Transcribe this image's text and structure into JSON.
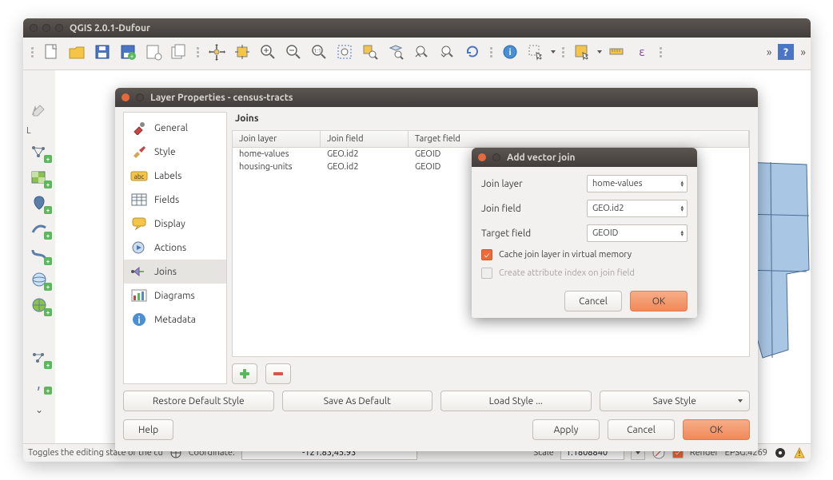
{
  "main_window": {
    "title": "QGIS 2.0.1-Dufour"
  },
  "layers_panel_label_fragment": "L",
  "statusbar": {
    "hint": "Toggles the editing state of the cu",
    "coord_label": "Coordinate:",
    "coord_value": "-121.83,45.93",
    "scale_label": "Scale",
    "scale_value": "1:1808840",
    "render_label": "Render",
    "crs": "EPSG:4269"
  },
  "props_dialog": {
    "title": "Layer Properties - census-tracts",
    "nav": [
      "General",
      "Style",
      "Labels",
      "Fields",
      "Display",
      "Actions",
      "Joins",
      "Diagrams",
      "Metadata"
    ],
    "content_title": "Joins",
    "table": {
      "headers": [
        "Join layer",
        "Join field",
        "Target field"
      ],
      "rows": [
        {
          "layer": "home-values",
          "field": "GEO.id2",
          "target": "GEOID"
        },
        {
          "layer": "housing-units",
          "field": "GEO.id2",
          "target": "GEOID"
        }
      ]
    },
    "style_buttons": [
      "Restore Default Style",
      "Save As Default",
      "Load Style ...",
      "Save Style"
    ],
    "help": "Help",
    "apply": "Apply",
    "cancel": "Cancel",
    "ok": "OK"
  },
  "join_dialog": {
    "title": "Add vector join",
    "join_layer_label": "Join layer",
    "join_layer_value": "home-values",
    "join_field_label": "Join field",
    "join_field_value": "GEO.id2",
    "target_field_label": "Target field",
    "target_field_value": "GEOID",
    "cache_label": "Cache join layer in virtual memory",
    "index_label": "Create attribute index on join field",
    "cancel": "Cancel",
    "ok": "OK"
  }
}
